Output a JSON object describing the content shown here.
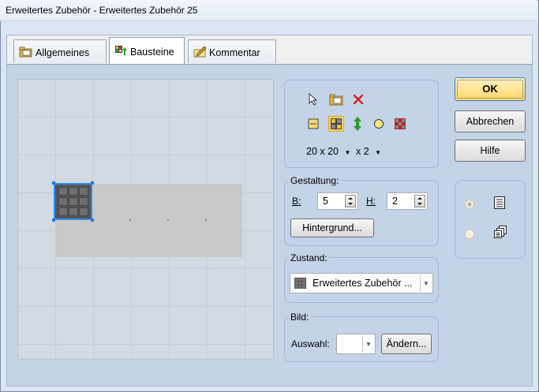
{
  "window": {
    "title": "Erweitertes Zubehör - Erweitertes Zubehör 25"
  },
  "tabs": [
    {
      "label": "Allgemeines"
    },
    {
      "label": "Bausteine"
    },
    {
      "label": "Kommentar"
    }
  ],
  "toolbar": {
    "grid_size": "20 x 20",
    "zoom": "x 2"
  },
  "gestaltung": {
    "label": "Gestaltung:",
    "b_label": "B:",
    "b_value": "5",
    "h_label": "H:",
    "h_value": "2",
    "background_button": "Hintergrund..."
  },
  "zustand": {
    "label": "Zustand:",
    "value": "Erweitertes Zubehör ..."
  },
  "bild": {
    "label": "Bild:",
    "auswahl_label": "Auswahl:",
    "auswahl_value": "",
    "change_button": "Ändern..."
  },
  "buttons": {
    "ok": "OK",
    "cancel": "Abbrechen",
    "help": "Hilfe"
  },
  "colors": {
    "accent_selection": "#2d8cf0",
    "delete_red": "#d42020",
    "panel_bg": "#c3d3e8"
  }
}
